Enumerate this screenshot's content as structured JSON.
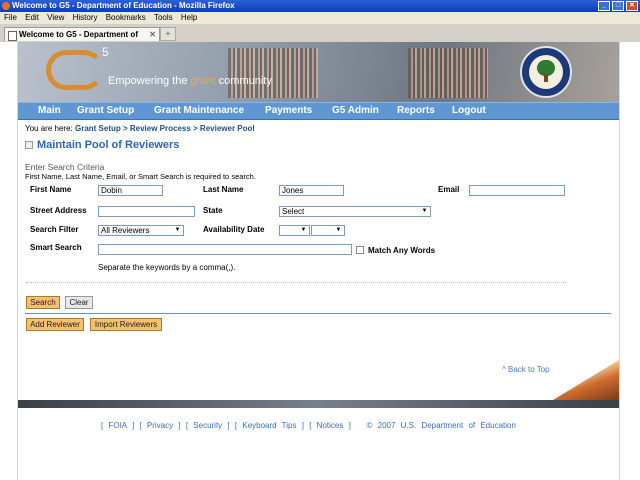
{
  "window": {
    "title": "Welcome to G5 - Department of Education - Mozilla Firefox",
    "controls": [
      "_",
      "□",
      "✕"
    ]
  },
  "menu": [
    "File",
    "Edit",
    "View",
    "History",
    "Bookmarks",
    "Tools",
    "Help"
  ],
  "tab": {
    "label": "Welcome to G5 - Department of Edu...",
    "close": "✕",
    "new": "+"
  },
  "banner": {
    "logo_num": "5",
    "tagline_a": "Empowering the ",
    "tagline_b": "grant",
    "tagline_c": " community"
  },
  "nav": [
    "Main",
    "Grant Setup",
    "Grant Maintenance",
    "Payments",
    "G5 Admin",
    "Reports",
    "Logout"
  ],
  "breadcrumb": {
    "prefix": "You are here:",
    "path": "Grant Setup > Review Process > Reviewer Pool"
  },
  "page": {
    "title": "Maintain Pool of Reviewers"
  },
  "form": {
    "heading": "Enter Search Criteria",
    "note": "First Name, Last Name, Email, or Smart Search is required to search.",
    "first_name_label": "First Name",
    "first_name_value": "Dobin",
    "last_name_label": "Last Name",
    "last_name_value": "Jones",
    "email_label": "Email",
    "email_value": "",
    "street_label": "Street Address",
    "street_value": "",
    "state_label": "State",
    "state_value": "Select",
    "filter_label": "Search Filter",
    "filter_value": "All Reviewers",
    "avail_label": "Availability Date",
    "smart_label": "Smart Search",
    "smart_value": "",
    "match_label": "Match Any Words",
    "keywords_hint": "Separate the keywords by a comma(,)."
  },
  "buttons": {
    "search": "Search",
    "clear": "Clear",
    "add_reviewer": "Add Reviewer",
    "import_reviewers": "Import Reviewers"
  },
  "back_to_top": "^ Back to Top",
  "footer": {
    "foia": "FOIA",
    "privacy": "Privacy",
    "security": "Security",
    "keyboard_tips": "Keyboard Tips",
    "notices": "Notices",
    "copyright": "© 2007 U.S. Department of Education"
  }
}
